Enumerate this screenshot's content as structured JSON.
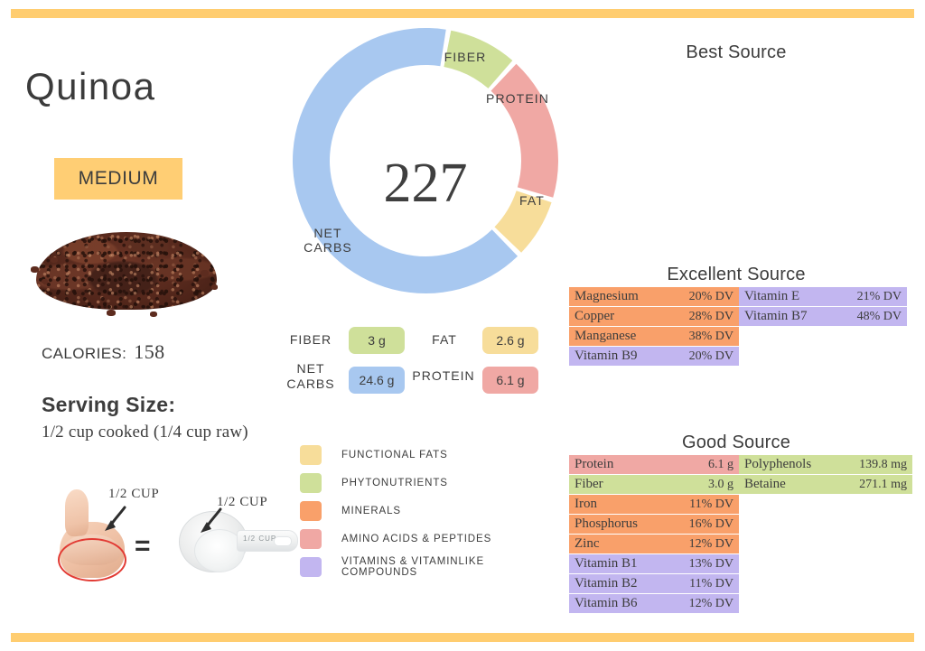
{
  "colors": {
    "accent_rule": "#ffcd70",
    "badge_bg": "#ffce74",
    "fat": "#f7dd9a",
    "fiber": "#cfe09a",
    "net_carbs": "#a8c8f0",
    "protein": "#f0a8a4",
    "minerals": "#f9a06a",
    "vitamins": "#c2b6f0",
    "text": "#3d3d3d"
  },
  "header": {
    "food_name": "Quinoa",
    "rating_badge": "MEDIUM"
  },
  "left_panel": {
    "calories_label": "CALORIES:",
    "calories_value": "158",
    "serving_title": "Serving Size:",
    "serving_description": "1/2 cup cooked (1/4 cup raw)",
    "portion_hand_label": "1/2 CUP",
    "portion_cup_label": "1/2 CUP",
    "portion_equals": "=",
    "cup_measure_text": "1/2  CUP"
  },
  "donut": {
    "center_value": "227",
    "segments": [
      {
        "label": "FIBER",
        "value": 3,
        "percent": 8.9,
        "color": "#cfe09a"
      },
      {
        "label": "PROTEIN",
        "value": 6.1,
        "percent": 18.1,
        "color": "#f0a8a4"
      },
      {
        "label": "FAT",
        "value": 2.6,
        "percent": 7.7,
        "color": "#f7dd9a"
      },
      {
        "label": "NET\nCARBS",
        "value": 24.6,
        "percent": 65.3,
        "color": "#a8c8f0"
      }
    ]
  },
  "chart_data": {
    "type": "pie",
    "title": "227",
    "categories": [
      "FIBER",
      "PROTEIN",
      "FAT",
      "NET CARBS"
    ],
    "values": [
      3,
      6.1,
      2.6,
      24.6
    ],
    "units": "g",
    "colors": [
      "#cfe09a",
      "#f0a8a4",
      "#f7dd9a",
      "#a8c8f0"
    ],
    "legend_position": "inline-labels",
    "notes": "Donut chart of macronutrient grams; center shows total calories-equivalent value 227"
  },
  "macros": [
    {
      "label": "FIBER",
      "value": "3 g",
      "color": "#cfe09a"
    },
    {
      "label": "FAT",
      "value": "2.6 g",
      "color": "#f7dd9a"
    },
    {
      "label": "NET\nCARBS",
      "value": "24.6 g",
      "color": "#a8c8f0"
    },
    {
      "label": "PROTEIN",
      "value": "6.1 g",
      "color": "#f0a8a4"
    }
  ],
  "legend": [
    {
      "label": "FUNCTIONAL  FATS",
      "color": "#f7dd9a"
    },
    {
      "label": "PHYTONUTRIENTS",
      "color": "#cfe09a"
    },
    {
      "label": "MINERALS",
      "color": "#f9a06a"
    },
    {
      "label": "AMINO ACIDS & PEPTIDES",
      "color": "#f0a8a4"
    },
    {
      "label": "VITAMINS & VITAMINLIKE COMPOUNDS",
      "color": "#c2b6f0"
    }
  ],
  "sources": {
    "best": {
      "heading": "Best Source",
      "left_column": [],
      "right_column": []
    },
    "excellent": {
      "heading": "Excellent Source",
      "left_column": [
        {
          "name": "Magnesium",
          "value": "20% DV",
          "color": "#f9a06a"
        },
        {
          "name": "Copper",
          "value": "28% DV",
          "color": "#f9a06a"
        },
        {
          "name": "Manganese",
          "value": "38% DV",
          "color": "#f9a06a"
        },
        {
          "name": "Vitamin B9",
          "value": "20% DV",
          "color": "#c2b6f0"
        }
      ],
      "right_column": [
        {
          "name": "Vitamin E",
          "value": "21% DV",
          "color": "#c2b6f0"
        },
        {
          "name": "Vitamin B7",
          "value": "48% DV",
          "color": "#c2b6f0"
        }
      ]
    },
    "good": {
      "heading": "Good Source",
      "left_column": [
        {
          "name": "Protein",
          "value": "6.1 g",
          "color": "#f0a8a4"
        },
        {
          "name": "Fiber",
          "value": "3.0 g",
          "color": "#cfe09a"
        },
        {
          "name": "Iron",
          "value": "11% DV",
          "color": "#f9a06a"
        },
        {
          "name": "Phosphorus",
          "value": "16% DV",
          "color": "#f9a06a"
        },
        {
          "name": "Zinc",
          "value": "12% DV",
          "color": "#f9a06a"
        },
        {
          "name": "Vitamin B1",
          "value": "13% DV",
          "color": "#c2b6f0"
        },
        {
          "name": "Vitamin B2",
          "value": "11% DV",
          "color": "#c2b6f0"
        },
        {
          "name": "Vitamin B6",
          "value": "12% DV",
          "color": "#c2b6f0"
        }
      ],
      "right_column": [
        {
          "name": "Polyphenols",
          "value": "139.8 mg",
          "color": "#cfe09a"
        },
        {
          "name": "Betaine",
          "value": "271.1 mg",
          "color": "#cfe09a"
        }
      ]
    }
  }
}
